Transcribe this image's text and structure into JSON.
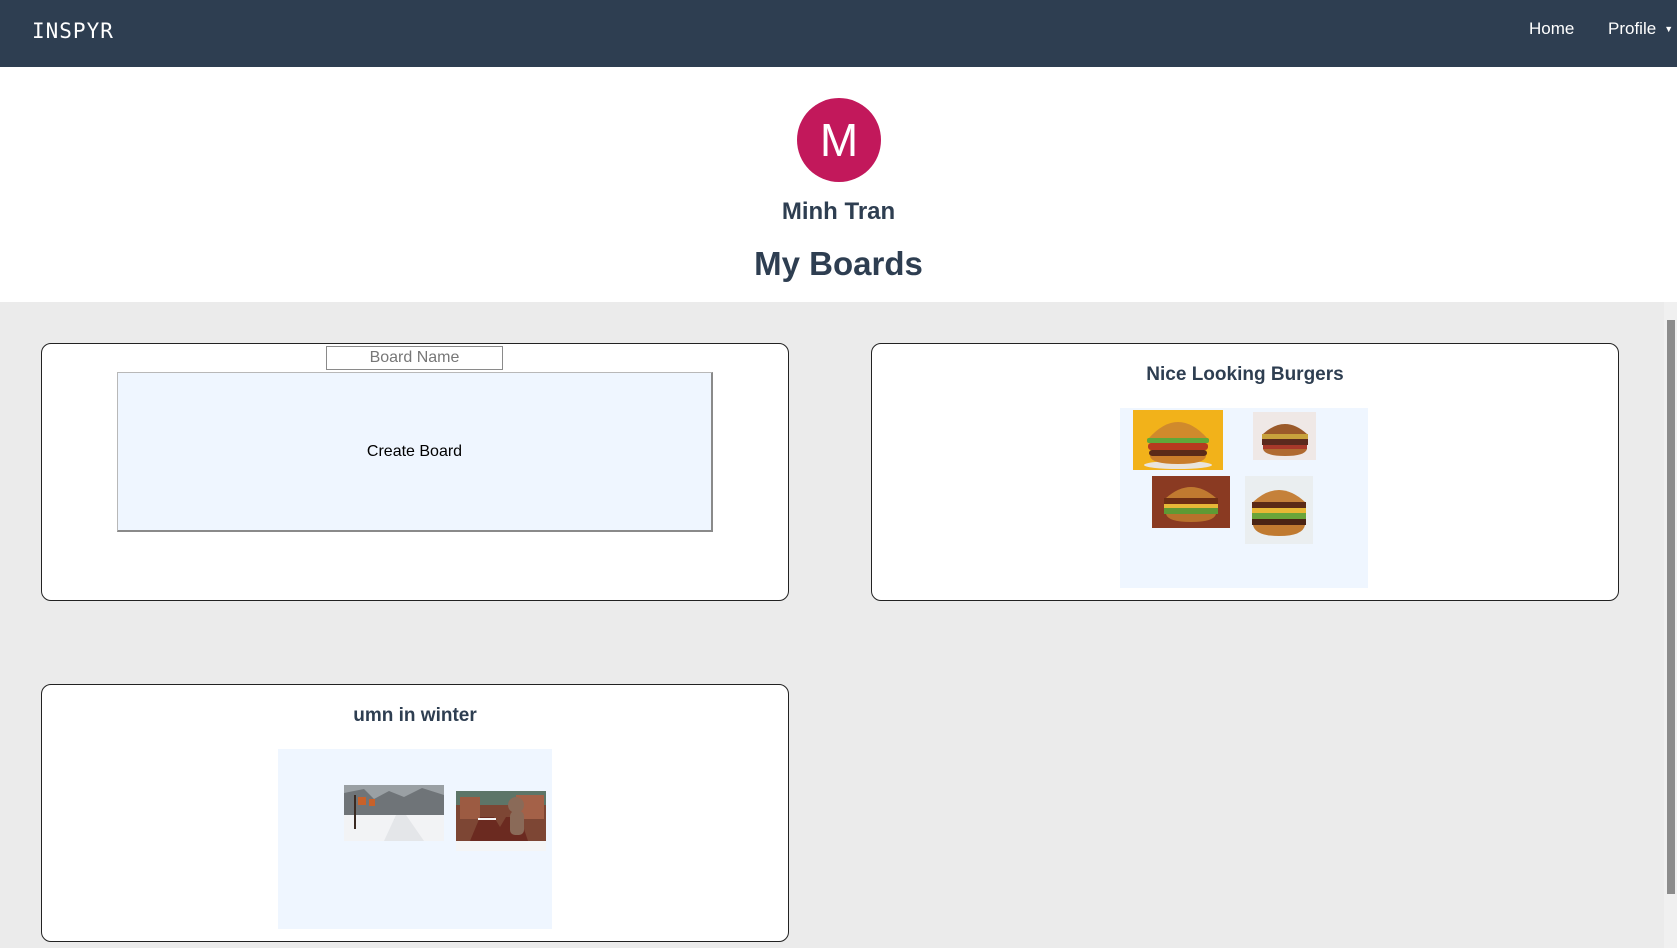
{
  "navbar": {
    "brand": "INSPYR",
    "home_label": "Home",
    "profile_label": "Profile",
    "background": "#2e3e51"
  },
  "profile": {
    "avatar_letter": "M",
    "avatar_color": "#c2185b",
    "name": "Minh Tran"
  },
  "page_title": "My Boards",
  "create_board": {
    "input_placeholder": "Board Name",
    "button_label": "Create Board"
  },
  "boards": [
    {
      "title": "Nice Looking Burgers",
      "images": [
        "burger-image",
        "burger-image",
        "burger-image",
        "burger-image"
      ]
    },
    {
      "title": "umn in winter",
      "images": [
        "snowy-campus-walkway-image",
        "gopher-statue-in-snow-image"
      ]
    }
  ]
}
